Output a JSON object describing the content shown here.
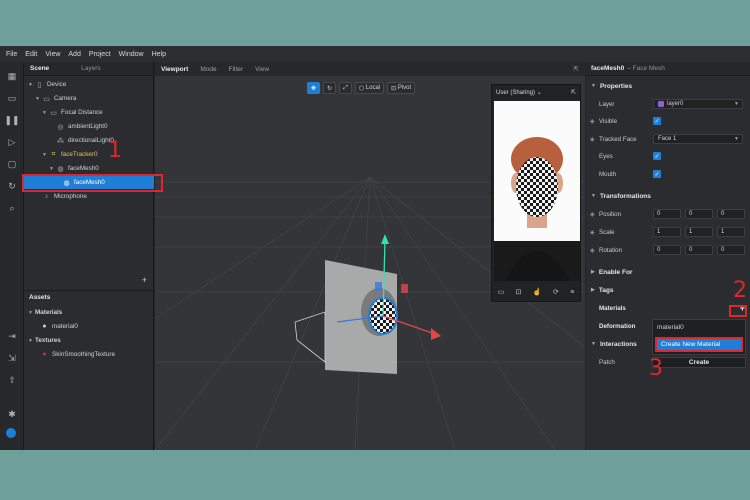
{
  "menubar": [
    "File",
    "Edit",
    "View",
    "Add",
    "Project",
    "Window",
    "Help"
  ],
  "scene_panel": {
    "tabs": [
      "Scene",
      "Layers"
    ],
    "tree": [
      {
        "label": "Device",
        "icon": "device-icon",
        "depth": 0
      },
      {
        "label": "Camera",
        "icon": "camera-icon",
        "depth": 1
      },
      {
        "label": "Focal Distance",
        "icon": "focal-distance-icon",
        "depth": 2
      },
      {
        "label": "ambientLight0",
        "icon": "ambient-light-icon",
        "depth": 3
      },
      {
        "label": "directionalLight0",
        "icon": "directional-light-icon",
        "depth": 3
      },
      {
        "label": "faceTracker0",
        "icon": "face-tracker-icon",
        "depth": 2
      },
      {
        "label": "faceMesh0",
        "icon": "face-mesh-icon",
        "depth": 3
      },
      {
        "label": "faceMesh0",
        "icon": "face-mesh-icon",
        "depth": 4,
        "selected": true
      },
      {
        "label": "Microphone",
        "icon": "microphone-icon",
        "depth": 1
      }
    ],
    "add_symbol": "+",
    "assets": {
      "title": "Assets",
      "materials_label": "Materials",
      "material": "material0",
      "textures_label": "Textures",
      "texture": "SkinSmoothingTexture"
    }
  },
  "viewport": {
    "tabs": [
      "Viewport",
      "Mode",
      "Filter",
      "View"
    ],
    "toolbar": {
      "local": "Local",
      "pivot": "Pivot"
    },
    "preview": {
      "device_label": "User (Sharing)"
    }
  },
  "properties": {
    "object_name": "faceMesh0",
    "object_type": "– Face Mesh",
    "sections": {
      "properties": "Properties",
      "transformations": "Transformations",
      "enable_for": "Enable For",
      "tags": "Tags",
      "interactions": "Interactions"
    },
    "layer_label": "Layer",
    "layer_value": "layer0",
    "visible_label": "Visible",
    "tracked_face_label": "Tracked Face",
    "tracked_face_value": "Face 1",
    "eyes_label": "Eyes",
    "mouth_label": "Mouth",
    "position_label": "Position",
    "position": [
      "0",
      "0",
      "0"
    ],
    "scale_label": "Scale",
    "scale": [
      "1",
      "1",
      "1"
    ],
    "rotation_label": "Rotation",
    "rotation": [
      "0",
      "0",
      "0"
    ],
    "materials_label": "Materials",
    "deformation_label": "Deformation",
    "patch_label": "Patch",
    "create_label": "Create",
    "dropdown": {
      "item": "material0",
      "create_new": "Create New Material"
    }
  },
  "annotations": {
    "step1": "1",
    "step2": "2",
    "step3": "3",
    "color": "#e0262a"
  }
}
